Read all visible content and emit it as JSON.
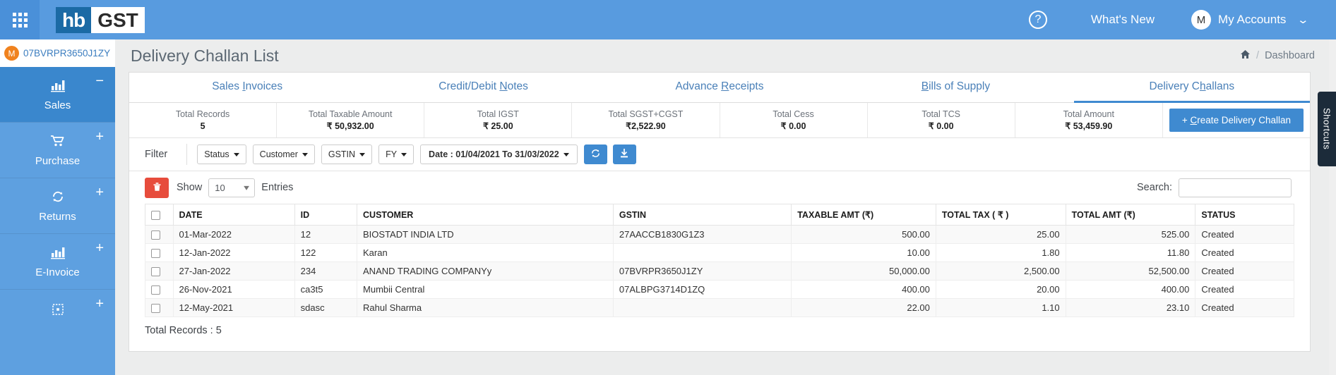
{
  "topbar": {
    "apps_icon": "apps-grid-icon",
    "logo_part1": "hb",
    "logo_part2": "GST",
    "help_icon": "?",
    "whats_new": "What's New",
    "avatar_initial": "M",
    "account_label": "My Accounts",
    "chevron": "⌄",
    "bg_color": "#589bdf"
  },
  "sidebar": {
    "gstin_badge": "M",
    "gstin": "07BVRPR3650J1ZY",
    "items": [
      {
        "label": "Sales",
        "icon": "bar-chart-icon",
        "glyph": "📊",
        "toggle": "−",
        "active": true
      },
      {
        "label": "Purchase",
        "icon": "cart-icon",
        "glyph": "🛒",
        "toggle": "+",
        "active": false
      },
      {
        "label": "Returns",
        "icon": "refresh-icon",
        "glyph": "↻",
        "toggle": "+",
        "active": false
      },
      {
        "label": "E-Invoice",
        "icon": "bar-chart-icon",
        "glyph": "📊",
        "toggle": "+",
        "active": false
      },
      {
        "label": "",
        "icon": "grid-icon",
        "glyph": "⊞",
        "toggle": "+",
        "active": false
      }
    ]
  },
  "page": {
    "title": "Delivery Challan List",
    "breadcrumb_home_icon": "home-icon",
    "breadcrumb_sep": "/",
    "breadcrumb_last": "Dashboard"
  },
  "tabs": [
    {
      "label": "Sales Invoices",
      "pre": "Sales ",
      "key": "I",
      "post": "nvoices",
      "active": false
    },
    {
      "label": "Credit/Debit Notes",
      "pre": "Credit/Debit ",
      "key": "N",
      "post": "otes",
      "active": false
    },
    {
      "label": "Advance Receipts",
      "pre": "Advance ",
      "key": "R",
      "post": "eceipts",
      "active": false
    },
    {
      "label": "Bills of Supply",
      "pre": "",
      "key": "B",
      "post": "ills of Supply",
      "active": false
    },
    {
      "label": "Delivery Challans",
      "pre": "Delivery C",
      "key": "h",
      "post": "allans",
      "active": true
    }
  ],
  "stats": [
    {
      "label": "Total Records",
      "value": "5"
    },
    {
      "label": "Total Taxable Amount",
      "value": "₹ 50,932.00"
    },
    {
      "label": "Total IGST",
      "value": "₹ 25.00"
    },
    {
      "label": "Total SGST+CGST",
      "value": "₹2,522.90"
    },
    {
      "label": "Total Cess",
      "value": "₹ 0.00"
    },
    {
      "label": "Total TCS",
      "value": "₹ 0.00"
    },
    {
      "label": "Total Amount",
      "value": "₹ 53,459.90"
    }
  ],
  "create_button": {
    "prefix": "+ ",
    "key": "C",
    "rest": "reate Delivery Challan"
  },
  "filter": {
    "label": "Filter",
    "dropdowns": [
      {
        "label": "Status"
      },
      {
        "label": "Customer"
      },
      {
        "label": "GSTIN"
      },
      {
        "label": "FY"
      }
    ],
    "date_label": "Date : 01/04/2021 To 31/03/2022",
    "refresh_icon": "↻",
    "download_icon": "⬇"
  },
  "toolbar": {
    "delete_icon": "🗑",
    "show_label": "Show",
    "page_size": "10",
    "entries_label": "Entries",
    "search_label": "Search:",
    "search_value": "",
    "search_placeholder": ""
  },
  "table": {
    "columns": [
      "DATE",
      "ID",
      "CUSTOMER",
      "GSTIN",
      "TAXABLE AMT (₹)",
      "TOTAL TAX ( ₹ )",
      "TOTAL AMT (₹)",
      "STATUS"
    ],
    "rows": [
      {
        "date": "01-Mar-2022",
        "id": "12",
        "customer": "BIOSTADT INDIA LTD",
        "gstin": "27AACCB1830G1Z3",
        "taxable": "500.00",
        "tax": "25.00",
        "total": "525.00",
        "status": "Created"
      },
      {
        "date": "12-Jan-2022",
        "id": "122",
        "customer": "Karan",
        "gstin": "",
        "taxable": "10.00",
        "tax": "1.80",
        "total": "11.80",
        "status": "Created"
      },
      {
        "date": "27-Jan-2022",
        "id": "234",
        "customer": "ANAND TRADING COMPANYy",
        "gstin": "07BVRPR3650J1ZY",
        "taxable": "50,000.00",
        "tax": "2,500.00",
        "total": "52,500.00",
        "status": "Created"
      },
      {
        "date": "26-Nov-2021",
        "id": "ca3t5",
        "customer": "Mumbii Central",
        "gstin": "07ALBPG3714D1ZQ",
        "taxable": "400.00",
        "tax": "20.00",
        "total": "400.00",
        "status": "Created"
      },
      {
        "date": "12-May-2021",
        "id": "sdasc",
        "customer": "Rahul Sharma",
        "gstin": "",
        "taxable": "22.00",
        "tax": "1.10",
        "total": "23.10",
        "status": "Created"
      }
    ],
    "footer": "Total Records : 5"
  },
  "shortcuts": {
    "label": "Shortcuts"
  },
  "colors": {
    "brand_blue": "#3f8ad0",
    "topbar_blue": "#589bdf",
    "sidebar_blue": "#5ea0e0",
    "sidebar_active": "#3a87cd",
    "danger_red": "#e74c3c",
    "badge_orange": "#f0821e",
    "dark_navy": "#1c2b3a"
  }
}
